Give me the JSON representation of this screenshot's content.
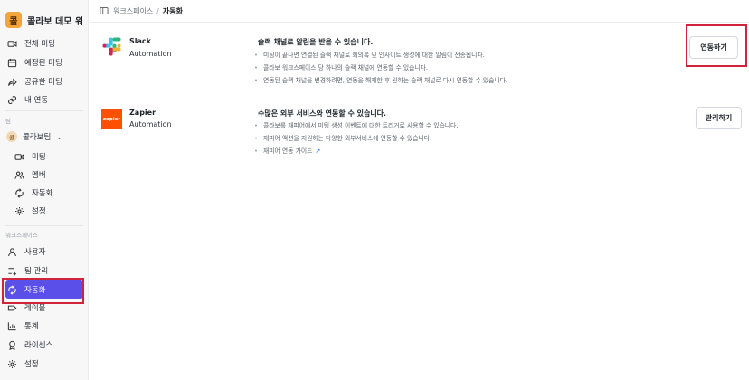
{
  "workspace": {
    "logo_char": "콜",
    "name": "콜라보 데모 워..."
  },
  "sidebar": {
    "main_items": [
      {
        "label": "전체 미팅",
        "icon": "video-icon"
      },
      {
        "label": "예정된 미팅",
        "icon": "calendar-icon"
      },
      {
        "label": "공유한 미팅",
        "icon": "share-icon"
      },
      {
        "label": "내 연동",
        "icon": "link-icon"
      }
    ],
    "team_section_label": "팀",
    "team": {
      "avatar_char": "콜",
      "name": "콜라보팀"
    },
    "team_items": [
      {
        "label": "미팅",
        "icon": "video-icon"
      },
      {
        "label": "멤버",
        "icon": "members-icon"
      },
      {
        "label": "자동화",
        "icon": "automation-icon"
      },
      {
        "label": "설정",
        "icon": "gear-icon"
      }
    ],
    "workspace_section_label": "워크스페이스",
    "workspace_items": [
      {
        "label": "사용자",
        "icon": "user-icon"
      },
      {
        "label": "팀 관리",
        "icon": "team-manage-icon"
      },
      {
        "label": "자동화",
        "icon": "automation-icon",
        "active": true
      },
      {
        "label": "레이블",
        "icon": "label-icon"
      },
      {
        "label": "통계",
        "icon": "stats-icon"
      },
      {
        "label": "라이센스",
        "icon": "license-icon"
      },
      {
        "label": "설정",
        "icon": "gear-icon"
      }
    ]
  },
  "breadcrumb": {
    "workspace": "워크스페이스",
    "separator": "/",
    "current": "자동화"
  },
  "integrations": [
    {
      "name": "Slack",
      "subtitle": "Automation",
      "desc_title": "슬랙 채널로 알림을 받을 수 있습니다.",
      "bullets": [
        "미팅이 끝나면 연결된 슬랙 채널로 회의록 및 인사이트 생성에 대한 알림이 전송됩니다.",
        "콜라보 워크스페이스 당 하나의 슬랙 채널에 연동할 수 있습니다.",
        "연동된 슬랙 채널을 변경하려면, 연동을 해제한 후 원하는 슬랙 채널로 다시 연동할 수 있습니다."
      ],
      "button": "연동하기"
    },
    {
      "name": "Zapier",
      "logo_text": "zapier",
      "subtitle": "Automation",
      "desc_title": "수많은 외부 서비스와 연동할 수 있습니다.",
      "bullets": [
        "콜라보를 재피어에서 미팅 생성 이벤트에 대한 트리거로 사용할 수 있습니다.",
        "재피어 액션을 지원하는 다양한 외부서비스에 연동할 수 있습니다.",
        "재피어 연동 가이드"
      ],
      "button": "관리하기"
    }
  ],
  "colors": {
    "accent": "#5a4fe8",
    "highlight": "#d0243a",
    "zapier": "#ff4f00",
    "workspace_logo": "#f3a53b"
  }
}
